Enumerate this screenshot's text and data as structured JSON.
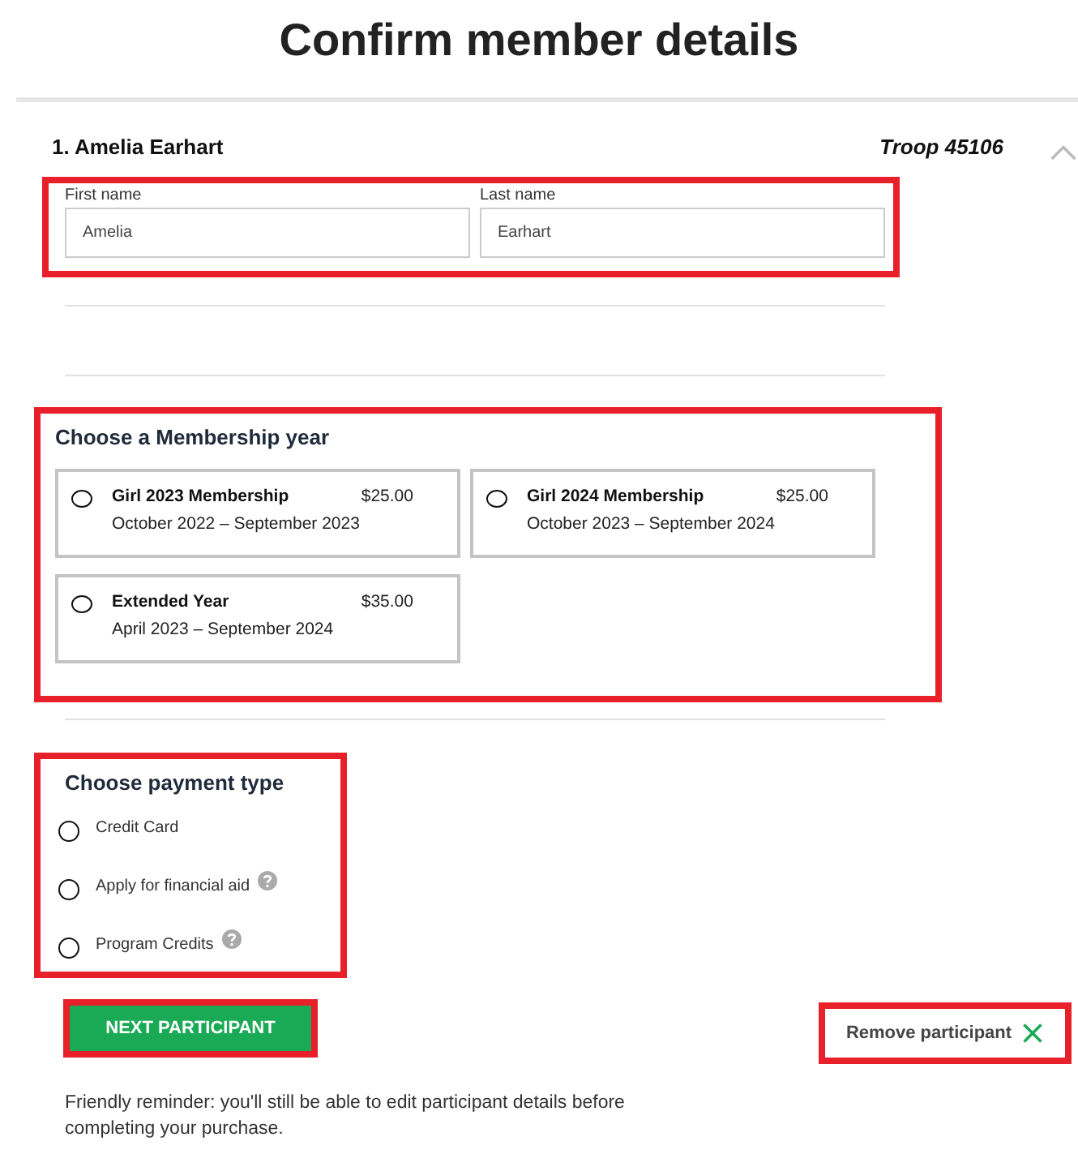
{
  "page_title": "Confirm member details",
  "participant": {
    "name": "1. Amelia Earhart",
    "troop": "Troop 45106",
    "expanded": true
  },
  "name_fields": {
    "highlighted": true,
    "fields": [
      {
        "label": "First name",
        "value": "Amelia"
      },
      {
        "label": "Last name",
        "value": "Earhart"
      }
    ]
  },
  "membership": {
    "heading": "Choose a Membership year",
    "highlighted": true,
    "options": [
      {
        "name": "Girl 2023 Membership",
        "price": "$25.00",
        "period": "October 2022 – September 2023",
        "selected": false
      },
      {
        "name": "Girl 2024 Membership",
        "price": "$25.00",
        "period": "October 2023 – September 2024",
        "selected": false
      },
      {
        "name": "Extended Year",
        "price": "$35.00",
        "period": "April 2023 – September 2024",
        "selected": false
      }
    ]
  },
  "payment": {
    "heading": "Choose payment type",
    "highlighted": true,
    "options": [
      {
        "label": "Credit Card",
        "help": false,
        "selected": false
      },
      {
        "label": "Apply for financial aid",
        "help": true,
        "selected": false
      },
      {
        "label": "Program Credits",
        "help": true,
        "selected": false
      }
    ]
  },
  "next_button": {
    "label": "NEXT PARTICIPANT",
    "highlighted": true
  },
  "remove_button": {
    "label": "Remove participant",
    "highlighted": true
  },
  "reminder": "Friendly reminder: you'll still be able to edit participant details before completing your purchase."
}
